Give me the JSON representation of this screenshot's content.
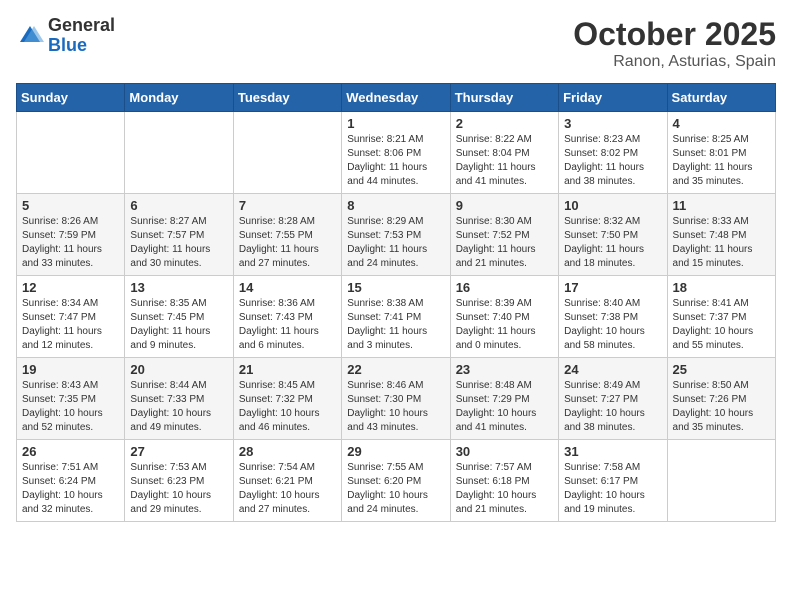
{
  "logo": {
    "general": "General",
    "blue": "Blue"
  },
  "header": {
    "month": "October 2025",
    "location": "Ranon, Asturias, Spain"
  },
  "weekdays": [
    "Sunday",
    "Monday",
    "Tuesday",
    "Wednesday",
    "Thursday",
    "Friday",
    "Saturday"
  ],
  "weeks": [
    [
      {
        "day": "",
        "sunrise": "",
        "sunset": "",
        "daylight": ""
      },
      {
        "day": "",
        "sunrise": "",
        "sunset": "",
        "daylight": ""
      },
      {
        "day": "",
        "sunrise": "",
        "sunset": "",
        "daylight": ""
      },
      {
        "day": "1",
        "sunrise": "8:21 AM",
        "sunset": "8:06 PM",
        "daylight": "11 hours and 44 minutes."
      },
      {
        "day": "2",
        "sunrise": "8:22 AM",
        "sunset": "8:04 PM",
        "daylight": "11 hours and 41 minutes."
      },
      {
        "day": "3",
        "sunrise": "8:23 AM",
        "sunset": "8:02 PM",
        "daylight": "11 hours and 38 minutes."
      },
      {
        "day": "4",
        "sunrise": "8:25 AM",
        "sunset": "8:01 PM",
        "daylight": "11 hours and 35 minutes."
      }
    ],
    [
      {
        "day": "5",
        "sunrise": "8:26 AM",
        "sunset": "7:59 PM",
        "daylight": "11 hours and 33 minutes."
      },
      {
        "day": "6",
        "sunrise": "8:27 AM",
        "sunset": "7:57 PM",
        "daylight": "11 hours and 30 minutes."
      },
      {
        "day": "7",
        "sunrise": "8:28 AM",
        "sunset": "7:55 PM",
        "daylight": "11 hours and 27 minutes."
      },
      {
        "day": "8",
        "sunrise": "8:29 AM",
        "sunset": "7:53 PM",
        "daylight": "11 hours and 24 minutes."
      },
      {
        "day": "9",
        "sunrise": "8:30 AM",
        "sunset": "7:52 PM",
        "daylight": "11 hours and 21 minutes."
      },
      {
        "day": "10",
        "sunrise": "8:32 AM",
        "sunset": "7:50 PM",
        "daylight": "11 hours and 18 minutes."
      },
      {
        "day": "11",
        "sunrise": "8:33 AM",
        "sunset": "7:48 PM",
        "daylight": "11 hours and 15 minutes."
      }
    ],
    [
      {
        "day": "12",
        "sunrise": "8:34 AM",
        "sunset": "7:47 PM",
        "daylight": "11 hours and 12 minutes."
      },
      {
        "day": "13",
        "sunrise": "8:35 AM",
        "sunset": "7:45 PM",
        "daylight": "11 hours and 9 minutes."
      },
      {
        "day": "14",
        "sunrise": "8:36 AM",
        "sunset": "7:43 PM",
        "daylight": "11 hours and 6 minutes."
      },
      {
        "day": "15",
        "sunrise": "8:38 AM",
        "sunset": "7:41 PM",
        "daylight": "11 hours and 3 minutes."
      },
      {
        "day": "16",
        "sunrise": "8:39 AM",
        "sunset": "7:40 PM",
        "daylight": "11 hours and 0 minutes."
      },
      {
        "day": "17",
        "sunrise": "8:40 AM",
        "sunset": "7:38 PM",
        "daylight": "10 hours and 58 minutes."
      },
      {
        "day": "18",
        "sunrise": "8:41 AM",
        "sunset": "7:37 PM",
        "daylight": "10 hours and 55 minutes."
      }
    ],
    [
      {
        "day": "19",
        "sunrise": "8:43 AM",
        "sunset": "7:35 PM",
        "daylight": "10 hours and 52 minutes."
      },
      {
        "day": "20",
        "sunrise": "8:44 AM",
        "sunset": "7:33 PM",
        "daylight": "10 hours and 49 minutes."
      },
      {
        "day": "21",
        "sunrise": "8:45 AM",
        "sunset": "7:32 PM",
        "daylight": "10 hours and 46 minutes."
      },
      {
        "day": "22",
        "sunrise": "8:46 AM",
        "sunset": "7:30 PM",
        "daylight": "10 hours and 43 minutes."
      },
      {
        "day": "23",
        "sunrise": "8:48 AM",
        "sunset": "7:29 PM",
        "daylight": "10 hours and 41 minutes."
      },
      {
        "day": "24",
        "sunrise": "8:49 AM",
        "sunset": "7:27 PM",
        "daylight": "10 hours and 38 minutes."
      },
      {
        "day": "25",
        "sunrise": "8:50 AM",
        "sunset": "7:26 PM",
        "daylight": "10 hours and 35 minutes."
      }
    ],
    [
      {
        "day": "26",
        "sunrise": "7:51 AM",
        "sunset": "6:24 PM",
        "daylight": "10 hours and 32 minutes."
      },
      {
        "day": "27",
        "sunrise": "7:53 AM",
        "sunset": "6:23 PM",
        "daylight": "10 hours and 29 minutes."
      },
      {
        "day": "28",
        "sunrise": "7:54 AM",
        "sunset": "6:21 PM",
        "daylight": "10 hours and 27 minutes."
      },
      {
        "day": "29",
        "sunrise": "7:55 AM",
        "sunset": "6:20 PM",
        "daylight": "10 hours and 24 minutes."
      },
      {
        "day": "30",
        "sunrise": "7:57 AM",
        "sunset": "6:18 PM",
        "daylight": "10 hours and 21 minutes."
      },
      {
        "day": "31",
        "sunrise": "7:58 AM",
        "sunset": "6:17 PM",
        "daylight": "10 hours and 19 minutes."
      },
      {
        "day": "",
        "sunrise": "",
        "sunset": "",
        "daylight": ""
      }
    ]
  ]
}
